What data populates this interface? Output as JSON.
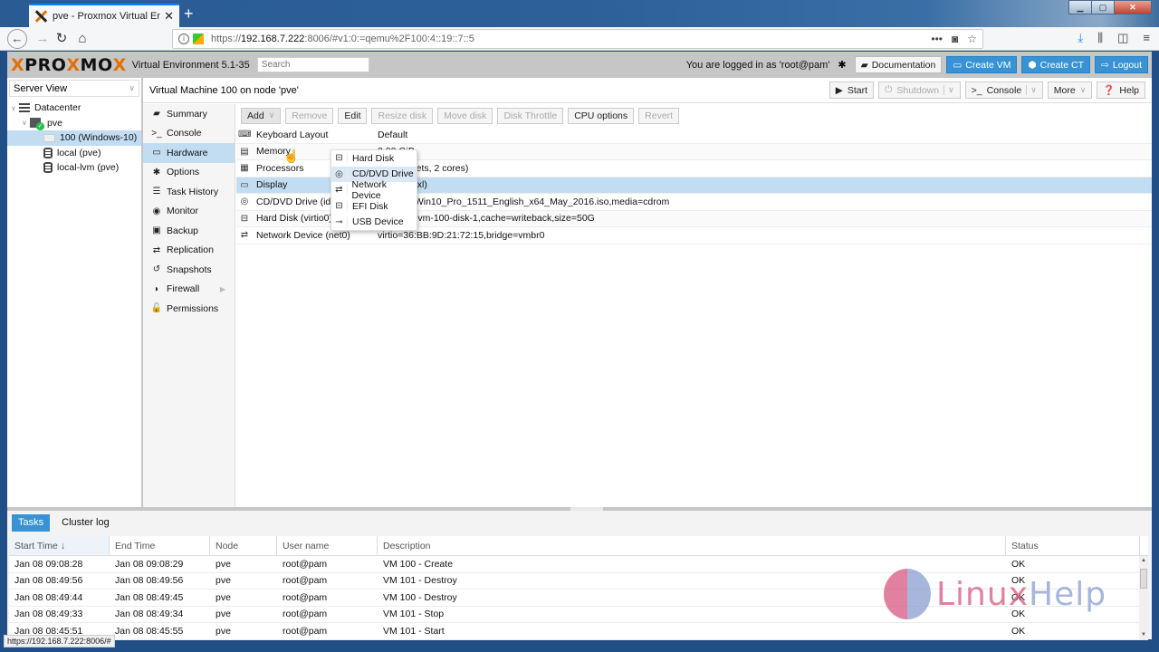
{
  "browser": {
    "tab_title": "pve - Proxmox Virtual Environm",
    "new_tab_label": "+",
    "url_scheme": "https://",
    "url_host": "192.168.7.222",
    "url_rest": ":8006/#v1:0:=qemu%2F100:4::19::7::5",
    "status_url": "https://192.168.7.222:8006/#"
  },
  "header": {
    "logo_x1": "X",
    "logo_pro": "PRO",
    "logo_x2": "X",
    "logo_mo": "MO",
    "logo_x3": "X",
    "product": "Virtual Environment 5.1-35",
    "search_placeholder": "Search",
    "logged_in": "You are logged in as 'root@pam'",
    "documentation": "Documentation",
    "create_vm": "Create VM",
    "create_ct": "Create CT",
    "logout": "Logout",
    "accent": "#3892d4"
  },
  "resource_tree": {
    "view": "Server View",
    "items": [
      {
        "label": "Datacenter",
        "icon": "datacenter-icon"
      },
      {
        "label": "pve",
        "icon": "node-online-icon"
      },
      {
        "label": "100 (Windows-10)",
        "icon": "vm-icon",
        "selected": true
      },
      {
        "label": "local (pve)",
        "icon": "storage-icon"
      },
      {
        "label": "local-lvm (pve)",
        "icon": "storage-icon"
      }
    ]
  },
  "content": {
    "title": "Virtual Machine 100 on node 'pve'",
    "actions": {
      "start": "Start",
      "shutdown": "Shutdown",
      "console": "Console",
      "more": "More",
      "help": "Help"
    }
  },
  "vm_nav": [
    {
      "label": "Summary",
      "icon": "book-icon",
      "glyph": "▰"
    },
    {
      "label": "Console",
      "icon": "terminal-icon",
      "glyph": ">_"
    },
    {
      "label": "Hardware",
      "icon": "desktop-icon",
      "glyph": "▭",
      "selected": true
    },
    {
      "label": "Options",
      "icon": "gear-icon",
      "glyph": "✱"
    },
    {
      "label": "Task History",
      "icon": "list-icon",
      "glyph": "☰"
    },
    {
      "label": "Monitor",
      "icon": "eye-icon",
      "glyph": "◉"
    },
    {
      "label": "Backup",
      "icon": "floppy-icon",
      "glyph": "▣"
    },
    {
      "label": "Replication",
      "icon": "retweet-icon",
      "glyph": "⇄"
    },
    {
      "label": "Snapshots",
      "icon": "history-icon",
      "glyph": "↺"
    },
    {
      "label": "Firewall",
      "icon": "shield-icon",
      "glyph": "◗",
      "submenu": true
    },
    {
      "label": "Permissions",
      "icon": "unlock-icon",
      "glyph": "🔓"
    }
  ],
  "hardware_toolbar": {
    "add": "Add",
    "remove": "Remove",
    "edit": "Edit",
    "resize_disk": "Resize disk",
    "move_disk": "Move disk",
    "disk_throttle": "Disk Throttle",
    "cpu_options": "CPU options",
    "revert": "Revert"
  },
  "add_menu": [
    {
      "label": "Hard Disk",
      "icon": "hdd-icon",
      "glyph": "⊟"
    },
    {
      "label": "CD/DVD Drive",
      "icon": "cdrom-icon",
      "glyph": "◎",
      "hover": true
    },
    {
      "label": "Network Device",
      "icon": "exchange-icon",
      "glyph": "⇄"
    },
    {
      "label": "EFI Disk",
      "icon": "hdd-icon",
      "glyph": "⊟"
    },
    {
      "label": "USB Device",
      "icon": "usb-icon",
      "glyph": "⊸"
    }
  ],
  "hardware_rows": [
    {
      "name": "Keyboard Layout",
      "value": "Default",
      "icon": "keyboard-icon",
      "glyph": "⌨"
    },
    {
      "name": "Memory",
      "value": "2.00 GiB",
      "icon": "memory-icon",
      "glyph": "▤"
    },
    {
      "name": "Processors",
      "value": "2 (1 sockets, 2 cores)",
      "icon": "cpu-icon",
      "glyph": "▦"
    },
    {
      "name": "Display",
      "value": "SPICE (qxl)",
      "icon": "desktop-icon",
      "glyph": "▭",
      "selected": true
    },
    {
      "name": "CD/DVD Drive (ide2)",
      "value": "local:iso/Win10_Pro_1511_English_x64_May_2016.iso,media=cdrom",
      "icon": "cdrom-icon",
      "glyph": "◎"
    },
    {
      "name": "Hard Disk (virtio0)",
      "value": "local-lvm:vm-100-disk-1,cache=writeback,size=50G",
      "icon": "hdd-icon",
      "glyph": "⊟"
    },
    {
      "name": "Network Device (net0)",
      "value": "virtio=36:BB:9D:21:72:15,bridge=vmbr0",
      "icon": "exchange-icon",
      "glyph": "⇄"
    }
  ],
  "log_panel": {
    "tabs": [
      "Tasks",
      "Cluster log"
    ],
    "active_tab": "Tasks",
    "columns": [
      "Start Time ↓",
      "End Time",
      "Node",
      "User name",
      "Description",
      "Status"
    ],
    "rows": [
      [
        "Jan 08 09:08:28",
        "Jan 08 09:08:29",
        "pve",
        "root@pam",
        "VM 100 - Create",
        "OK"
      ],
      [
        "Jan 08 08:49:56",
        "Jan 08 08:49:56",
        "pve",
        "root@pam",
        "VM 101 - Destroy",
        "OK"
      ],
      [
        "Jan 08 08:49:44",
        "Jan 08 08:49:45",
        "pve",
        "root@pam",
        "VM 100 - Destroy",
        "OK"
      ],
      [
        "Jan 08 08:49:33",
        "Jan 08 08:49:34",
        "pve",
        "root@pam",
        "VM 101 - Stop",
        "OK"
      ],
      [
        "Jan 08 08:45:51",
        "Jan 08 08:45:55",
        "pve",
        "root@pam",
        "VM 101 - Start",
        "OK"
      ]
    ]
  },
  "watermark": {
    "part1": "Linux",
    "part2": "Help"
  }
}
